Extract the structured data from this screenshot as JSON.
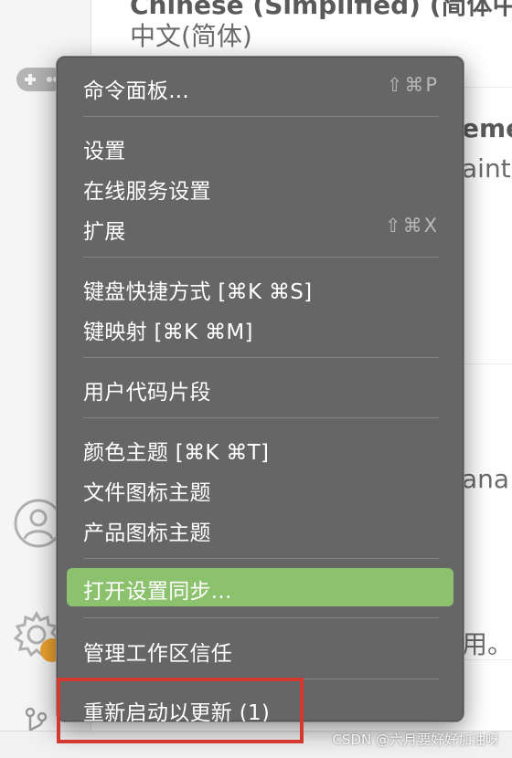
{
  "background": {
    "title_partial": "Chinese (Simplified) (简体中",
    "subtitle": "中文(简体)",
    "frag_theme": "eme",
    "frag_maint": "ainta",
    "frag_mana": "ana",
    "frag_yong": "用。"
  },
  "menu": {
    "command_palette": {
      "label": "命令面板...",
      "shortcut": "⇧⌘P"
    },
    "settings": {
      "label": "设置"
    },
    "online_services": {
      "label": "在线服务设置"
    },
    "extensions": {
      "label": "扩展",
      "shortcut": "⇧⌘X"
    },
    "keyboard_shortcuts": {
      "label": "键盘快捷方式 [⌘K ⌘S]"
    },
    "keymaps": {
      "label": "键映射 [⌘K ⌘M]"
    },
    "user_snippets": {
      "label": "用户代码片段"
    },
    "color_theme": {
      "label": "颜色主题 [⌘K ⌘T]"
    },
    "file_icon_theme": {
      "label": "文件图标主题"
    },
    "product_icon_theme": {
      "label": "产品图标主题"
    },
    "settings_sync": {
      "label": "打开设置同步..."
    },
    "workspace_trust": {
      "label": "管理工作区信任"
    },
    "restart_update": {
      "label": "重新启动以更新 (1)"
    }
  },
  "colors": {
    "menu_bg": "#666666",
    "active_item": "#8cc26e",
    "annotation_border": "#d4382e"
  },
  "watermark": "CSDN @六月要好好加油呀"
}
